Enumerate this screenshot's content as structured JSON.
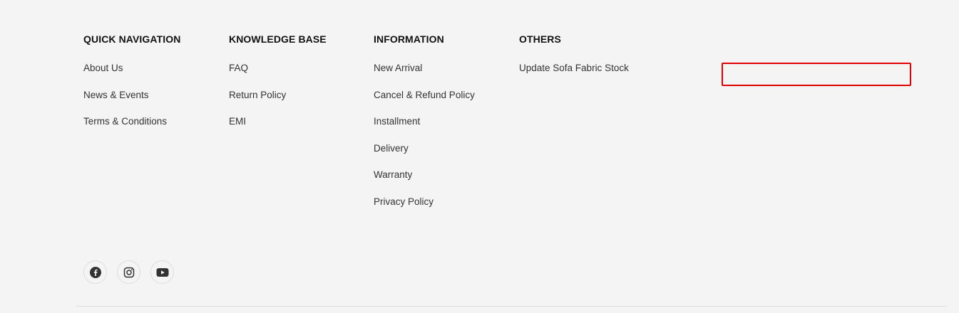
{
  "footer": {
    "columns": [
      {
        "heading": "QUICK NAVIGATION",
        "links": [
          "About Us",
          "News & Events",
          "Terms & Conditions"
        ]
      },
      {
        "heading": "KNOWLEDGE BASE",
        "links": [
          "FAQ",
          "Return Policy",
          "EMI"
        ]
      },
      {
        "heading": "INFORMATION",
        "links": [
          "New Arrival",
          "Cancel & Refund Policy",
          "Installment",
          "Delivery",
          "Warranty",
          "Privacy Policy"
        ]
      },
      {
        "heading": "OTHERS",
        "links": [
          "Update Sofa Fabric Stock"
        ]
      }
    ],
    "newsletter_input": {
      "value": "",
      "placeholder": ""
    },
    "social": [
      {
        "icon": "facebook-icon"
      },
      {
        "icon": "instagram-icon"
      },
      {
        "icon": "youtube-icon"
      }
    ]
  },
  "colors": {
    "background": "#f4f4f4",
    "highlight_border": "#e00000",
    "text": "#333333"
  }
}
